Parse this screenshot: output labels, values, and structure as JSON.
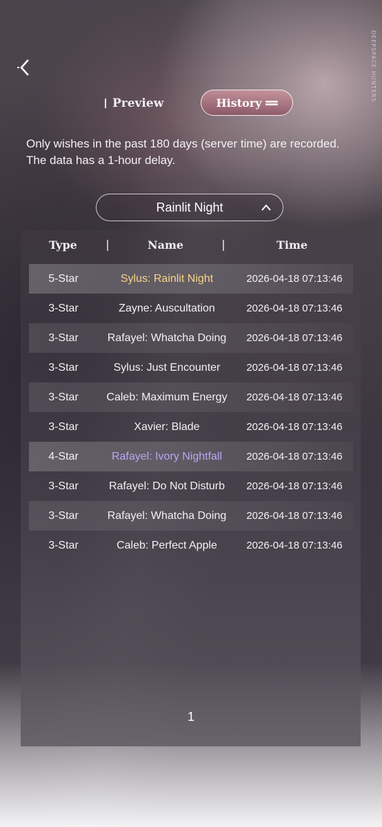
{
  "brand": "DEEPSPACE HUNTERS",
  "tabs": {
    "preview": "Preview",
    "history": "History"
  },
  "notice": {
    "line1": "Only wishes in the past 180 days (server time) are recorded.",
    "line2": "The data has a 1-hour delay."
  },
  "banner_select": {
    "value": "Rainlit Night"
  },
  "table": {
    "headers": {
      "type": "Type",
      "name": "Name",
      "time": "Time"
    },
    "rows": [
      {
        "type": "5-Star",
        "name": "Sylus: Rainlit Night",
        "time": "2026-04-18 07:13:46"
      },
      {
        "type": "3-Star",
        "name": "Zayne: Auscultation",
        "time": "2026-04-18 07:13:46"
      },
      {
        "type": "3-Star",
        "name": "Rafayel: Whatcha Doing",
        "time": "2026-04-18 07:13:46"
      },
      {
        "type": "3-Star",
        "name": "Sylus: Just Encounter",
        "time": "2026-04-18 07:13:46"
      },
      {
        "type": "3-Star",
        "name": "Caleb: Maximum Energy",
        "time": "2026-04-18 07:13:46"
      },
      {
        "type": "3-Star",
        "name": "Xavier: Blade",
        "time": "2026-04-18 07:13:46"
      },
      {
        "type": "4-Star",
        "name": "Rafayel: Ivory Nightfall",
        "time": "2026-04-18 07:13:46"
      },
      {
        "type": "3-Star",
        "name": "Rafayel: Do Not Disturb",
        "time": "2026-04-18 07:13:46"
      },
      {
        "type": "3-Star",
        "name": "Rafayel: Whatcha Doing",
        "time": "2026-04-18 07:13:46"
      },
      {
        "type": "3-Star",
        "name": "Caleb: Perfect Apple",
        "time": "2026-04-18 07:13:46"
      }
    ]
  },
  "pagination": {
    "current": "1"
  },
  "colors": {
    "five_star": "#f7d48a",
    "four_star": "#b9a8f5",
    "three_star": "#f3f0f4",
    "history_tab_bg": "#b06a7c"
  },
  "icons": {
    "back": "chevron-left-icon",
    "dropdown": "chevron-up-icon"
  }
}
